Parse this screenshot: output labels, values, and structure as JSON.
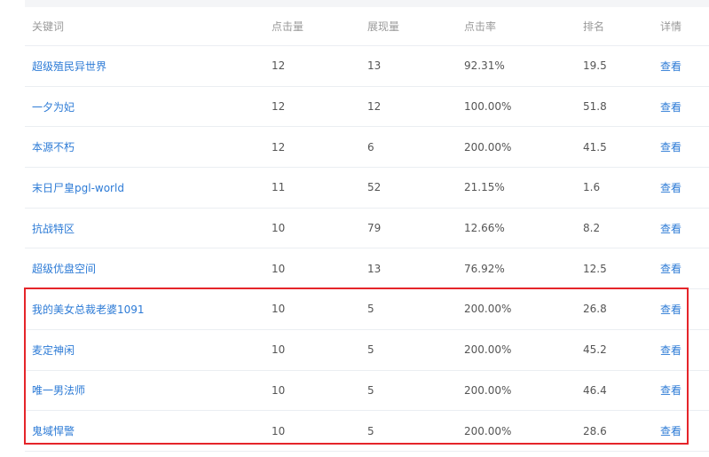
{
  "table": {
    "headers": {
      "keyword": "关键词",
      "clicks": "点击量",
      "impressions": "展现量",
      "ctr": "点击率",
      "rank": "排名",
      "detail": "详情"
    },
    "rows": [
      {
        "keyword": "超级殖民异世界",
        "clicks": "12",
        "impressions": "13",
        "ctr": "92.31%",
        "rank": "19.5",
        "detail": "查看"
      },
      {
        "keyword": "一夕为妃",
        "clicks": "12",
        "impressions": "12",
        "ctr": "100.00%",
        "rank": "51.8",
        "detail": "查看"
      },
      {
        "keyword": "本源不朽",
        "clicks": "12",
        "impressions": "6",
        "ctr": "200.00%",
        "rank": "41.5",
        "detail": "查看"
      },
      {
        "keyword": "末日尸皇pgl-world",
        "clicks": "11",
        "impressions": "52",
        "ctr": "21.15%",
        "rank": "1.6",
        "detail": "查看"
      },
      {
        "keyword": "抗战特区",
        "clicks": "10",
        "impressions": "79",
        "ctr": "12.66%",
        "rank": "8.2",
        "detail": "查看"
      },
      {
        "keyword": "超级优盘空间",
        "clicks": "10",
        "impressions": "13",
        "ctr": "76.92%",
        "rank": "12.5",
        "detail": "查看"
      },
      {
        "keyword": "我的美女总裁老婆1091",
        "clicks": "10",
        "impressions": "5",
        "ctr": "200.00%",
        "rank": "26.8",
        "detail": "查看"
      },
      {
        "keyword": "麦定神闲",
        "clicks": "10",
        "impressions": "5",
        "ctr": "200.00%",
        "rank": "45.2",
        "detail": "查看"
      },
      {
        "keyword": "唯一男法师",
        "clicks": "10",
        "impressions": "5",
        "ctr": "200.00%",
        "rank": "46.4",
        "detail": "查看"
      },
      {
        "keyword": "鬼域悍警",
        "clicks": "10",
        "impressions": "5",
        "ctr": "200.00%",
        "rank": "28.6",
        "detail": "查看"
      }
    ]
  },
  "colors": {
    "link": "#2d7bd6",
    "highlight_border": "#e5252a",
    "row_divider": "#ebeef2",
    "header_text": "#9a9a9a"
  }
}
